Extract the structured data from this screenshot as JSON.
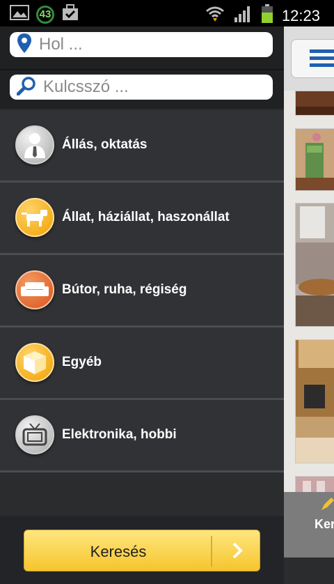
{
  "status": {
    "notification_count": "43",
    "time": "12:23"
  },
  "drawer": {
    "location_placeholder": "Hol ...",
    "keyword_placeholder": "Kulcsszó ...",
    "categories": [
      {
        "label": "Állás, oktatás",
        "icon": "person-tie-icon"
      },
      {
        "label": "Állat, háziállat, haszonállat",
        "icon": "dog-icon"
      },
      {
        "label": "Bútor, ruha, régiség",
        "icon": "sofa-icon"
      },
      {
        "label": "Egyéb",
        "icon": "box-icon"
      },
      {
        "label": "Elektronika, hobbi",
        "icon": "tv-icon"
      }
    ],
    "search_button": "Keresés"
  },
  "right_panel": {
    "partial_label": "Ker"
  },
  "colors": {
    "accent_yellow": "#f6c52d",
    "pin_blue": "#1f5fb0"
  }
}
